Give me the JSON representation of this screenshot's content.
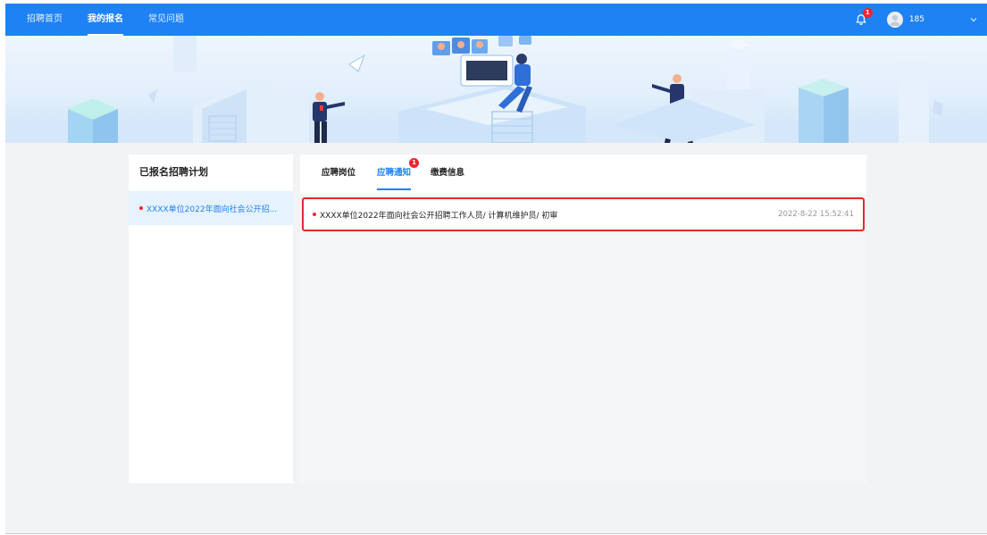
{
  "nav": {
    "items": [
      {
        "label": "招聘首页"
      },
      {
        "label": "我的报名"
      },
      {
        "label": "常见问题"
      }
    ],
    "active_index": 1,
    "notification_count": "1",
    "username": "185"
  },
  "sidebar": {
    "title": "已报名招聘计划",
    "items": [
      {
        "label": "XXXX单位2022年面向社会公开招..."
      }
    ]
  },
  "tabs": {
    "items": [
      {
        "label": "应聘岗位"
      },
      {
        "label": "应聘通知",
        "badge": "1"
      },
      {
        "label": "缴费信息"
      }
    ],
    "active_index": 1
  },
  "notices": [
    {
      "text": "XXXX单位2022年面向社会公开招聘工作人员/ 计算机维护员/ 初审",
      "time": "2022-8-22 15:52:41"
    }
  ],
  "colors": {
    "brand": "#1e82f5",
    "alert": "#f5222d",
    "highlight_border": "#e8282d"
  },
  "icons": [
    "bell-icon",
    "user-avatar-icon",
    "chevron-down-icon"
  ]
}
